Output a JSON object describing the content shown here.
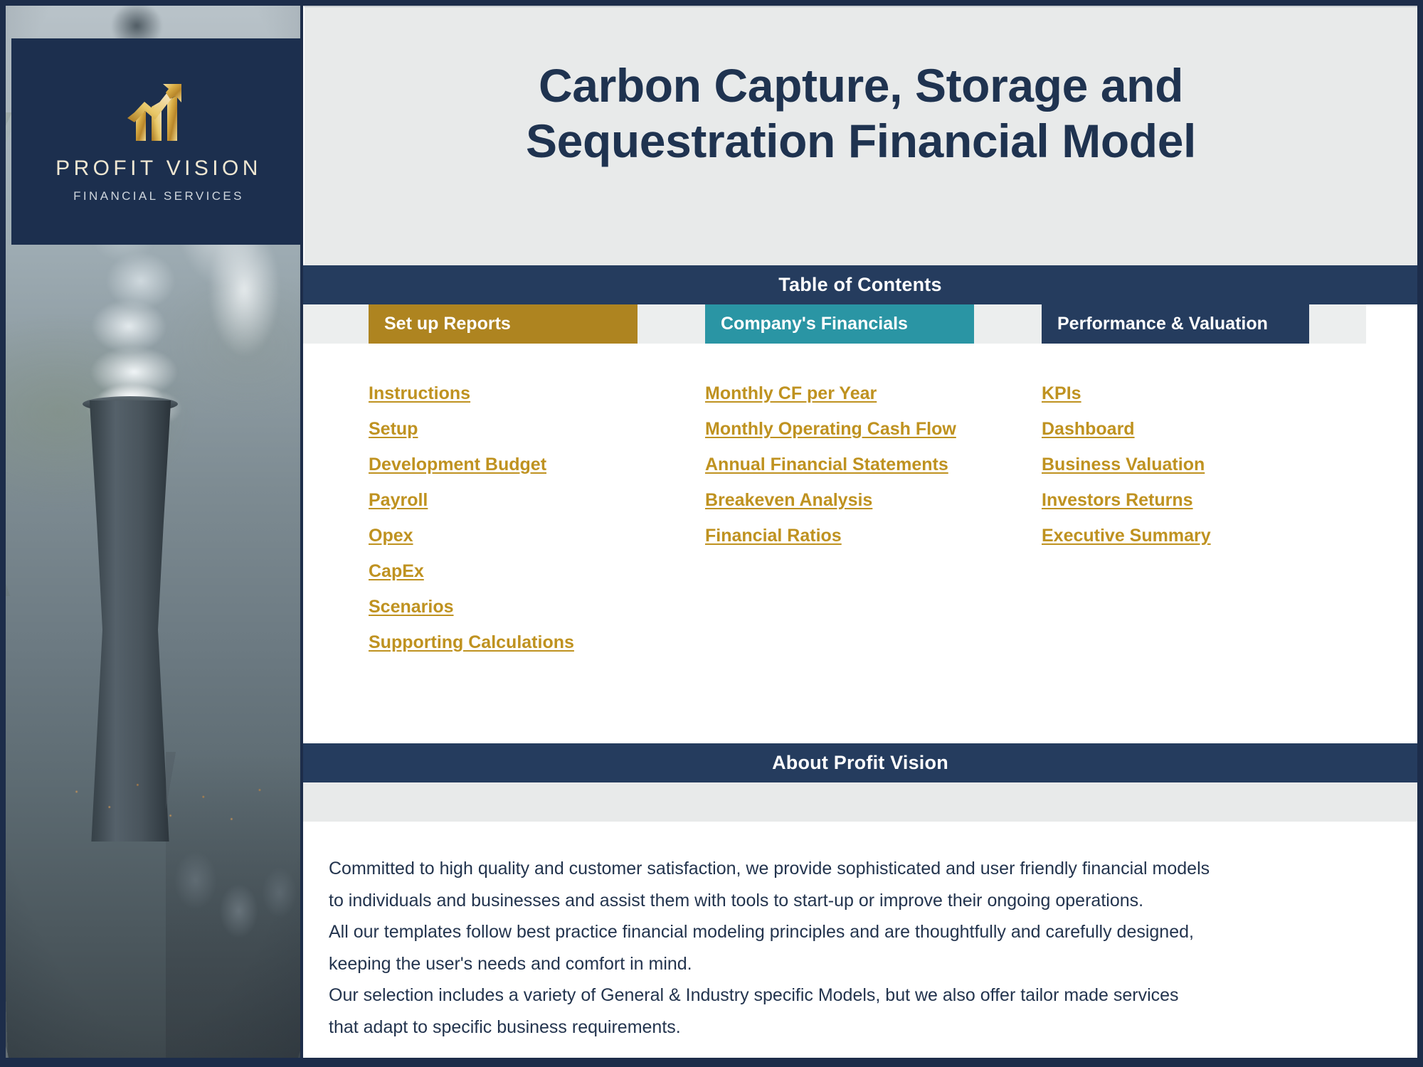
{
  "brand": {
    "name": "PROFIT VISION",
    "subtitle": "FINANCIAL SERVICES",
    "logo_icon": "growth-bar-chart-arrow-icon"
  },
  "header": {
    "title": "Carbon Capture, Storage and Sequestration Financial Model"
  },
  "sections": {
    "toc_bar_label": "Table of Contents",
    "about_bar_label": "About Profit Vision"
  },
  "toc": {
    "categories": [
      {
        "label": "Set up Reports",
        "color": "#ae8420"
      },
      {
        "label": "Company's Financials",
        "color": "#2a95a4"
      },
      {
        "label": "Performance & Valuation",
        "color": "#253c5e"
      }
    ],
    "columns": [
      {
        "category": "Set up Reports",
        "links": [
          "Instructions",
          "Setup",
          "Development Budget",
          "Payroll",
          "Opex",
          "CapEx",
          "Scenarios",
          "Supporting Calculations"
        ]
      },
      {
        "category": "Company's Financials",
        "links": [
          "Monthly CF per Year",
          "Monthly Operating Cash Flow",
          "Annual Financial Statements",
          "Breakeven Analysis",
          "Financial Ratios"
        ]
      },
      {
        "category": "Performance & Valuation",
        "links": [
          "KPIs",
          "Dashboard",
          "Business Valuation",
          "Investors Returns",
          "Executive Summary"
        ]
      }
    ]
  },
  "about": {
    "lines": [
      "Committed to high quality and customer satisfaction, we provide sophisticated and user friendly financial models",
      "to individuals and businesses and assist them  with tools to start-up or improve their ongoing operations.",
      "All our templates follow best practice financial modeling principles and are thoughtfully and carefully designed,",
      "keeping the user's needs and comfort in mind.",
      "Our selection includes a variety of General & Industry specific Models, but we also offer tailor made services",
      "that adapt to specific business requirements."
    ]
  },
  "colors": {
    "navy": "#253c5e",
    "logo_navy": "#1c2f4e",
    "gold": "#bf9220",
    "gold_header": "#ae8420",
    "teal": "#2a95a4",
    "light_gray": "#e8eaea",
    "title_text": "#1f3350"
  }
}
